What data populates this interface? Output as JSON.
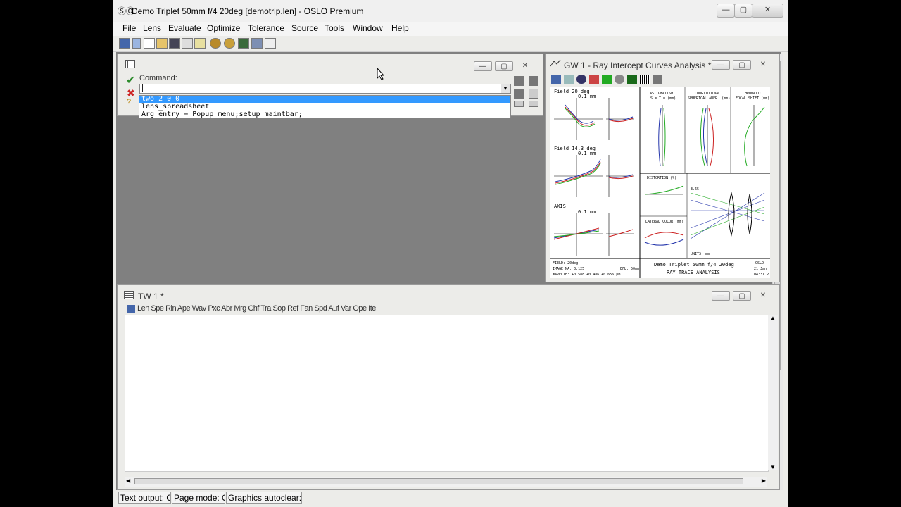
{
  "window": {
    "title": "Demo Triplet 50mm f/4 20deg [demotrip.len] - OSLO Premium",
    "logo_glyph": "ⓈⓄ",
    "minimize": "—",
    "maximize": "▢",
    "close": "✕"
  },
  "menu": [
    "File",
    "Lens",
    "Evaluate",
    "Optimize",
    "Tolerance",
    "Source",
    "Tools",
    "Window",
    "Help"
  ],
  "toolbar_icons": [
    "lens-spreadsheet-icon",
    "lens-icon",
    "new-icon",
    "open-icon",
    "save-icon",
    "edit-icon",
    "notepad-icon",
    "optimize-icon",
    "gear-icon",
    "color-icon",
    "printer-icon",
    "text-icon"
  ],
  "command_window": {
    "label": "Command:",
    "input_value": "|",
    "suggestions": [
      "two 2 0 0",
      "lens_spreadsheet",
      "Arg_entry = Popup_menu;setup_maintbar;"
    ],
    "accept_glyph": "✔",
    "cancel_glyph": "✖",
    "help_glyph": "?"
  },
  "graphics_window": {
    "title": "GW 1 - Ray Intercept Curves Analysis *",
    "plots": {
      "field_20": "Field 20 deg",
      "field_14": "Field 14.3 deg",
      "axis": "AXIS",
      "scale": "0.1 mm",
      "astig_title": "ASTIGMATISM",
      "astig_sub": "S = T = (mm)",
      "long_title": "LONGITUDINAL",
      "long_sub": "SPHERICAL ABER. (mm)",
      "chrom_title": "CHROMATIC",
      "chrom_sub": "FOCAL SHIFT (mm)",
      "distortion": "DISTORTION (%)",
      "lateral": "LATERAL COLOR (mm)",
      "field": "FIELD: 20deg",
      "image_na": "IMAGE NA: 0.125",
      "efl": "EFL: 50mm",
      "wavelength": "WAVELTH: +0.588 +0.486 +0.656 µm",
      "lens_name": "Demo Triplet 50mm f/4 20deg",
      "analysis": "RAY TRACE ANALYSIS",
      "oslo": "OSLO",
      "date": "21 Jan",
      "time": "04:31 P",
      "units": "UNITS: mm",
      "scale_val": "3.65"
    },
    "colors": {
      "red": "#cc2222",
      "blue": "#2233aa",
      "green": "#22aa22"
    }
  },
  "text_window": {
    "title": "TW 1 *",
    "buttons": [
      "Len",
      "Spe",
      "Rin",
      "Ape",
      "Wav",
      "Pxc",
      "Abr",
      "Mrg",
      "Chf",
      "Tra",
      "Sop",
      "Ref",
      "Fan",
      "Spd",
      "Auf",
      "Var",
      "Ope",
      "Ite"
    ]
  },
  "status": {
    "text_output": "Text output: O",
    "page_mode": "Page mode: O!",
    "graphics_autoclear": "Graphics autoclear: O"
  }
}
